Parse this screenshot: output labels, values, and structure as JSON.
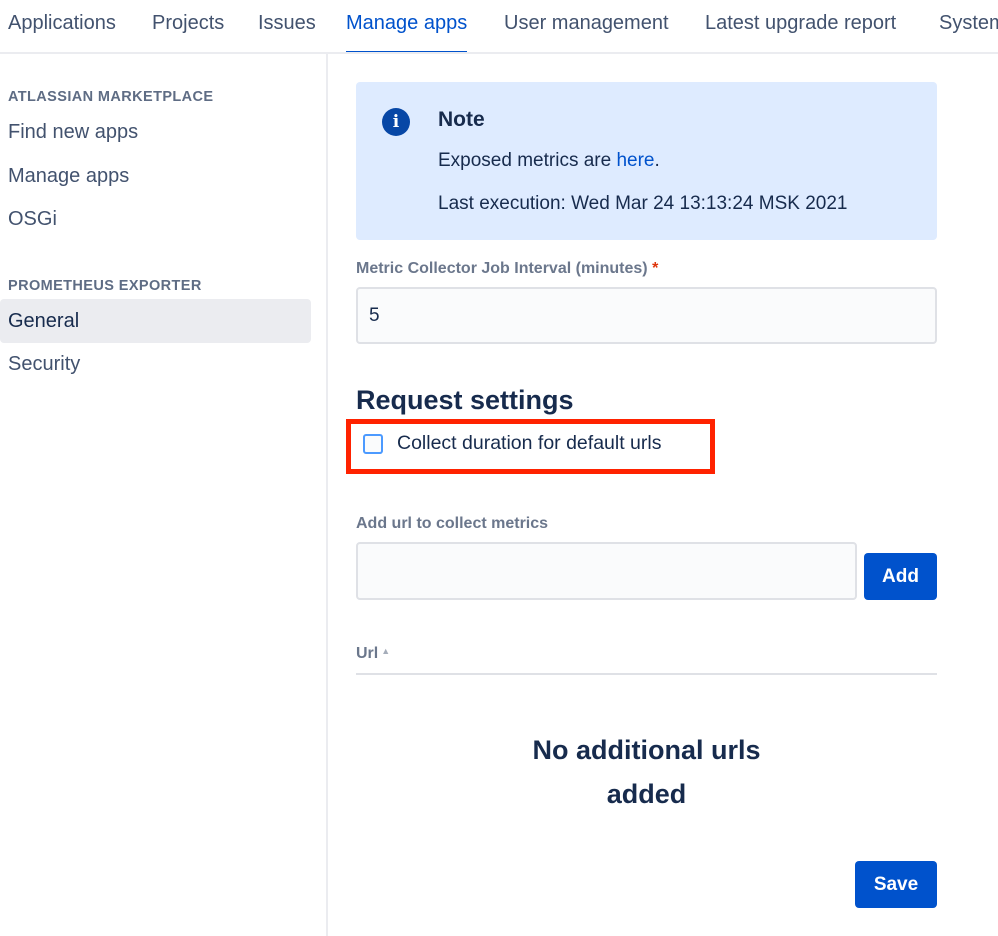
{
  "nav": {
    "tabs": [
      {
        "label": "Applications"
      },
      {
        "label": "Projects"
      },
      {
        "label": "Issues"
      },
      {
        "label": "Manage apps",
        "active": true
      },
      {
        "label": "User management"
      },
      {
        "label": "Latest upgrade report"
      },
      {
        "label": "System"
      }
    ]
  },
  "sidebar": {
    "sections": [
      {
        "heading": "ATLASSIAN MARKETPLACE",
        "items": [
          "Find new apps",
          "Manage apps",
          "OSGi"
        ]
      },
      {
        "heading": "PROMETHEUS EXPORTER",
        "items": [
          "General",
          "Security"
        ]
      }
    ],
    "selected": "General"
  },
  "note": {
    "icon": "info-icon",
    "title": "Note",
    "line1_prefix": "Exposed metrics are ",
    "line1_link": "here",
    "line1_suffix": ".",
    "line2": "Last execution: Wed Mar 24 13:13:24 MSK 2021"
  },
  "interval": {
    "label": "Metric Collector Job Interval (minutes)",
    "required_mark": "*",
    "value": "5"
  },
  "request_settings": {
    "title": "Request settings",
    "checkbox_label": "Collect duration for default urls",
    "checked": false
  },
  "add_url": {
    "label": "Add url to collect metrics",
    "value": "",
    "button": "Add"
  },
  "table": {
    "column": "Url",
    "sort_icon": "sort-ascending-icon",
    "empty_line1": "No additional urls",
    "empty_line2": "added"
  },
  "save_button": "Save",
  "colors": {
    "accent": "#0052cc",
    "note_bg": "#deebff",
    "highlight": "#ff2200"
  }
}
